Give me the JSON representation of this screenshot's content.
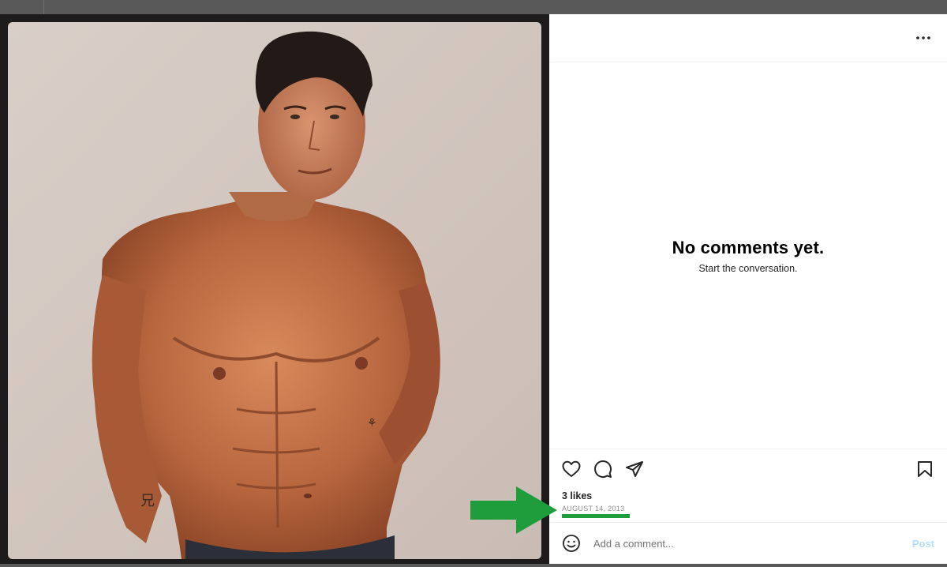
{
  "post": {
    "image_alt": "Shirtless man with tattoos posing against a light background",
    "more_icon": "more-horizontal-icon"
  },
  "comments": {
    "empty_title": "No comments yet.",
    "empty_subtitle": "Start the conversation."
  },
  "actions": {
    "like_icon": "heart-icon",
    "comment_icon": "comment-icon",
    "share_icon": "send-icon",
    "save_icon": "bookmark-icon"
  },
  "stats": {
    "likes_text": "3 likes",
    "date_text": "AUGUST 14, 2013"
  },
  "comment_box": {
    "emoji_icon": "emoji-icon",
    "placeholder": "Add a comment...",
    "post_label": "Post"
  },
  "annotation": {
    "arrow_icon": "arrow-right-icon",
    "highlight_color": "#1f9d3c"
  },
  "colors": {
    "post_button_disabled": "#b2dffc",
    "muted_text": "#8e8e8e",
    "divider": "#efefef"
  }
}
